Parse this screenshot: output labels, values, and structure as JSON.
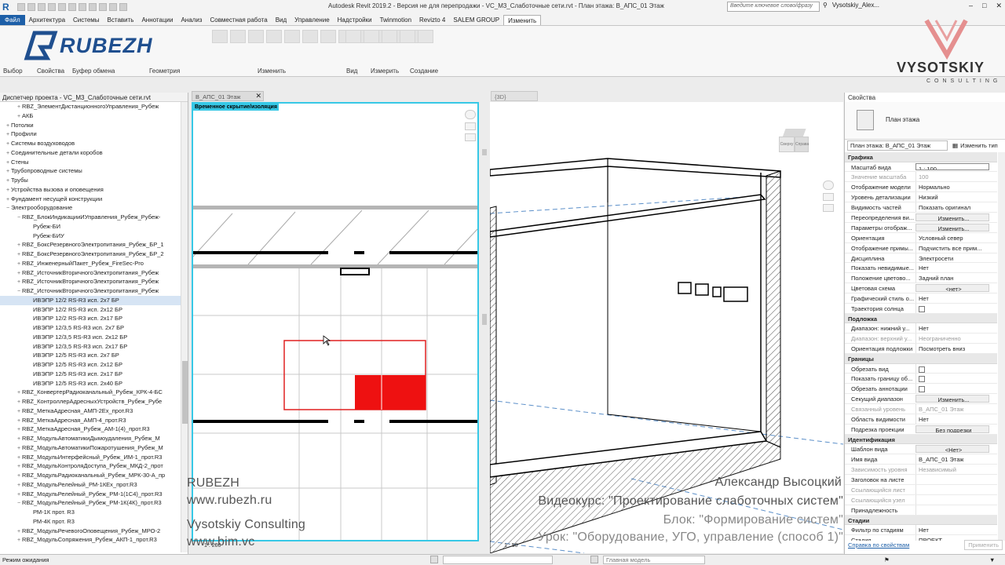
{
  "window": {
    "title": "Autodesk Revit 2019.2 - Версия не для перепродажи - VC_M3_Слаботочные сети.rvt - План этажа: В_АПС_01 Этаж",
    "search_placeholder": "Введите ключевое слово/фразу",
    "user": "Vysotskiy_Alex..."
  },
  "menu": {
    "file": "Файл",
    "tabs": [
      "Архитектура",
      "Системы",
      "Вставить",
      "Аннотации",
      "Анализ",
      "Совместная работа",
      "Вид",
      "Управление",
      "Надстройки",
      "Twinmotion",
      "Revizto 4",
      "SALEM GROUP",
      "Изменить"
    ],
    "active": "Изменить"
  },
  "ribbon": {
    "panels": [
      "Выбор",
      "Свойства",
      "Буфер обмена",
      "Геометрия",
      "Изменить",
      "Вид",
      "Измерить",
      "Создание"
    ]
  },
  "logos": {
    "rubezh": "RUBEZH",
    "vysotskiy": "VYSOTSKIY",
    "consulting": "CONSULTING"
  },
  "project_browser": {
    "title": "Диспетчер проекта - VC_M3_Слаботочные сети.rvt",
    "items": [
      {
        "t": "RBZ_ЭлементДистанционногоУправления_Рубеж",
        "lvl": 2,
        "ex": "+"
      },
      {
        "t": "АКБ",
        "lvl": 2,
        "ex": "+"
      },
      {
        "t": "Потолки",
        "lvl": 1,
        "ex": "+"
      },
      {
        "t": "Профили",
        "lvl": 1,
        "ex": "+"
      },
      {
        "t": "Системы воздуховодов",
        "lvl": 1,
        "ex": "+"
      },
      {
        "t": "Соединительные детали коробов",
        "lvl": 1,
        "ex": "+"
      },
      {
        "t": "Стены",
        "lvl": 1,
        "ex": "+"
      },
      {
        "t": "Трубопроводные системы",
        "lvl": 1,
        "ex": "+"
      },
      {
        "t": "Трубы",
        "lvl": 1,
        "ex": "+"
      },
      {
        "t": "Устройства вызова и оповещения",
        "lvl": 1,
        "ex": "+"
      },
      {
        "t": "Фундамент несущей конструкции",
        "lvl": 1,
        "ex": "+"
      },
      {
        "t": "Электрооборудование",
        "lvl": 1,
        "ex": "−"
      },
      {
        "t": "RBZ_БлокИндикацииИУправления_Рубеж_Рубеж-",
        "lvl": 2,
        "ex": "−"
      },
      {
        "t": "Рубеж-БИ",
        "lvl": 3,
        "ex": ""
      },
      {
        "t": "Рубеж-БИУ",
        "lvl": 3,
        "ex": ""
      },
      {
        "t": "RBZ_БоксРезервногоЭлектропитания_Рубеж_БР_1",
        "lvl": 2,
        "ex": "+"
      },
      {
        "t": "RBZ_БоксРезервногоЭлектропитания_Рубеж_БР_2",
        "lvl": 2,
        "ex": "+"
      },
      {
        "t": "RBZ_ИнженерныйПакет_Рубеж_FireSec-Pro",
        "lvl": 2,
        "ex": "+"
      },
      {
        "t": "RBZ_ИсточникВторичногоЭлектропитания_Рубеж",
        "lvl": 2,
        "ex": "+"
      },
      {
        "t": "RBZ_ИсточникВторичногоЭлектропитания_Рубеж",
        "lvl": 2,
        "ex": "+"
      },
      {
        "t": "RBZ_ИсточникВторичногоЭлектропитания_Рубеж",
        "lvl": 2,
        "ex": "−"
      },
      {
        "t": "ИВЭПР 12/2 RS-R3 исп. 2х7 БР",
        "lvl": 3,
        "ex": "",
        "sel": true
      },
      {
        "t": "ИВЭПР 12/2 RS-R3 исп. 2х12 БР",
        "lvl": 3,
        "ex": ""
      },
      {
        "t": "ИВЭПР 12/2 RS-R3 исп. 2х17 БР",
        "lvl": 3,
        "ex": ""
      },
      {
        "t": "ИВЭПР 12/3,5 RS-R3 исп. 2х7 БР",
        "lvl": 3,
        "ex": ""
      },
      {
        "t": "ИВЭПР 12/3,5 RS-R3 исп. 2х12 БР",
        "lvl": 3,
        "ex": ""
      },
      {
        "t": "ИВЭПР 12/3,5 RS-R3 исп. 2х17 БР",
        "lvl": 3,
        "ex": ""
      },
      {
        "t": "ИВЭПР 12/5 RS-R3 исп. 2х7 БР",
        "lvl": 3,
        "ex": ""
      },
      {
        "t": "ИВЭПР 12/5 RS-R3 исп. 2х12 БР",
        "lvl": 3,
        "ex": ""
      },
      {
        "t": "ИВЭПР 12/5 RS-R3 исп. 2х17 БР",
        "lvl": 3,
        "ex": ""
      },
      {
        "t": "ИВЭПР 12/5 RS-R3 исп. 2х40 БР",
        "lvl": 3,
        "ex": ""
      },
      {
        "t": "RBZ_КонвертерРадиоканальный_Рубеж_КРК-4-БС",
        "lvl": 2,
        "ex": "+"
      },
      {
        "t": "RBZ_КонтроллерАдресныхУстройств_Рубеж_Рубе",
        "lvl": 2,
        "ex": "+"
      },
      {
        "t": "RBZ_МеткаАдресная_АМП-2Ех_прот.R3",
        "lvl": 2,
        "ex": "+"
      },
      {
        "t": "RBZ_МеткаАдресная_АМП-4_прот.R3",
        "lvl": 2,
        "ex": "+"
      },
      {
        "t": "RBZ_МеткаАдресная_Рубеж_АМ-1(4)_прот.R3",
        "lvl": 2,
        "ex": "+"
      },
      {
        "t": "RBZ_МодульАвтоматикиДымоудаления_Рубеж_М",
        "lvl": 2,
        "ex": "+"
      },
      {
        "t": "RBZ_МодульАвтоматикиПожаротушения_Рубеж_М",
        "lvl": 2,
        "ex": "+"
      },
      {
        "t": "RBZ_МодульИнтерфейсный_Рубеж_ИМ-1_прот.R3",
        "lvl": 2,
        "ex": "+"
      },
      {
        "t": "RBZ_МодульКонтроляДоступа_Рубеж_МКД-2_прот",
        "lvl": 2,
        "ex": "+"
      },
      {
        "t": "RBZ_МодульРадиоканальный_Рубеж_МРК-30-А_пр",
        "lvl": 2,
        "ex": "+"
      },
      {
        "t": "RBZ_МодульРелейный_РМ-1КЕх_прот.R3",
        "lvl": 2,
        "ex": "+"
      },
      {
        "t": "RBZ_МодульРелейный_Рубеж_РМ-1(1С4)_прот.R3",
        "lvl": 2,
        "ex": "+"
      },
      {
        "t": "RBZ_МодульРелейный_Рубеж_РМ-1К(4К)_прот.R3",
        "lvl": 2,
        "ex": "−"
      },
      {
        "t": "РМ-1К прот. R3",
        "lvl": 3,
        "ex": ""
      },
      {
        "t": "РМ-4К прот. R3",
        "lvl": 3,
        "ex": ""
      },
      {
        "t": "RBZ_МодульРечевогоОповещения_Рубеж_МРО-2",
        "lvl": 2,
        "ex": "+"
      },
      {
        "t": "RBZ_МодульСопряжения_Рубеж_АКП-1_прот.R3",
        "lvl": 2,
        "ex": "+"
      }
    ]
  },
  "views": {
    "tab_plan": "В_АПС_01 Этаж",
    "tab_3d": "{3D}",
    "temp_hide_label": "Временное скрытие/изоляция",
    "scale_left": "1 : 200",
    "scale_right": "1 : 50",
    "viewcube_left": "Сверху",
    "viewcube_right": "Справа"
  },
  "properties": {
    "title": "Свойства",
    "type_name": "План этажа",
    "filter": "План этажа: В_АПС_01 Этаж",
    "edit_type": "Изменить тип",
    "sections": [
      {
        "name": "Графика",
        "rows": [
          {
            "k": "Масштаб вида",
            "v": "1 : 100",
            "kind": "input"
          },
          {
            "k": "Значение масштаба",
            "v": "100",
            "dis": true
          },
          {
            "k": "Отображение модели",
            "v": "Нормально"
          },
          {
            "k": "Уровень детализации",
            "v": "Низкий"
          },
          {
            "k": "Видимость частей",
            "v": "Показать оригинал"
          },
          {
            "k": "Переопределения ви...",
            "v": "Изменить...",
            "kind": "btn"
          },
          {
            "k": "Параметры отображ...",
            "v": "Изменить...",
            "kind": "btn"
          },
          {
            "k": "Ориентация",
            "v": "Условный север"
          },
          {
            "k": "Отображение примы...",
            "v": "Подчистить все прим..."
          },
          {
            "k": "Дисциплина",
            "v": "Электросети"
          },
          {
            "k": "Показать невидимые...",
            "v": "Нет"
          },
          {
            "k": "Положение цветово...",
            "v": "Задний план"
          },
          {
            "k": "Цветовая схема",
            "v": "<нет>",
            "kind": "btn"
          },
          {
            "k": "Графический стиль о...",
            "v": "Нет"
          },
          {
            "k": "Траектория солнца",
            "v": "",
            "kind": "cb"
          }
        ]
      },
      {
        "name": "Подложка",
        "rows": [
          {
            "k": "Диапазон: нижний у...",
            "v": "Нет"
          },
          {
            "k": "Диапазон: верхний у...",
            "v": "Неограниченно",
            "dis": true
          },
          {
            "k": "Ориентация подложки",
            "v": "Посмотреть вниз"
          }
        ]
      },
      {
        "name": "Границы",
        "rows": [
          {
            "k": "Обрезать вид",
            "v": "",
            "kind": "cb"
          },
          {
            "k": "Показать границу об...",
            "v": "",
            "kind": "cb"
          },
          {
            "k": "Обрезать аннотации",
            "v": "",
            "kind": "cb"
          },
          {
            "k": "Секущий диапазон",
            "v": "Изменить...",
            "kind": "btn"
          },
          {
            "k": "Связанный уровень",
            "v": "В_АПС_01 Этаж",
            "dis": true
          },
          {
            "k": "Область видимости",
            "v": "Нет"
          },
          {
            "k": "Подрезка проекции",
            "v": "Без подрезки",
            "kind": "btn"
          }
        ]
      },
      {
        "name": "Идентификация",
        "rows": [
          {
            "k": "Шаблон вида",
            "v": "<Нет>",
            "kind": "btn"
          },
          {
            "k": "Имя вида",
            "v": "В_АПС_01 Этаж"
          },
          {
            "k": "Зависимость уровня",
            "v": "Независимый",
            "dis": true
          },
          {
            "k": "Заголовок на листе",
            "v": ""
          },
          {
            "k": "Ссылающийся лист",
            "v": "",
            "dis": true
          },
          {
            "k": "Ссылающийся узел",
            "v": "",
            "dis": true
          },
          {
            "k": "Принадлежность",
            "v": ""
          }
        ]
      },
      {
        "name": "Стадии",
        "rows": [
          {
            "k": "Фильтр по стадиям",
            "v": "Нет"
          },
          {
            "k": "Стадия",
            "v": "ПРОЕКТ"
          }
        ]
      }
    ],
    "help_link": "Справка по свойствам",
    "apply": "Применить"
  },
  "status": {
    "text": "Режим ожидания",
    "model": "Главная модель"
  },
  "overlay": {
    "left": [
      "RUBEZH",
      "www.rubezh.ru",
      "Vysotskiy Consulting",
      "www.bim.vc"
    ],
    "author": "Александр Высоцкий",
    "course": "Видеокурс: \"Проектирование слаботочных систем\"",
    "block": "Блок: \"Формирование систем\"",
    "lesson": "Урок: \"Оборудование, УГО, управление (способ 1)\""
  }
}
